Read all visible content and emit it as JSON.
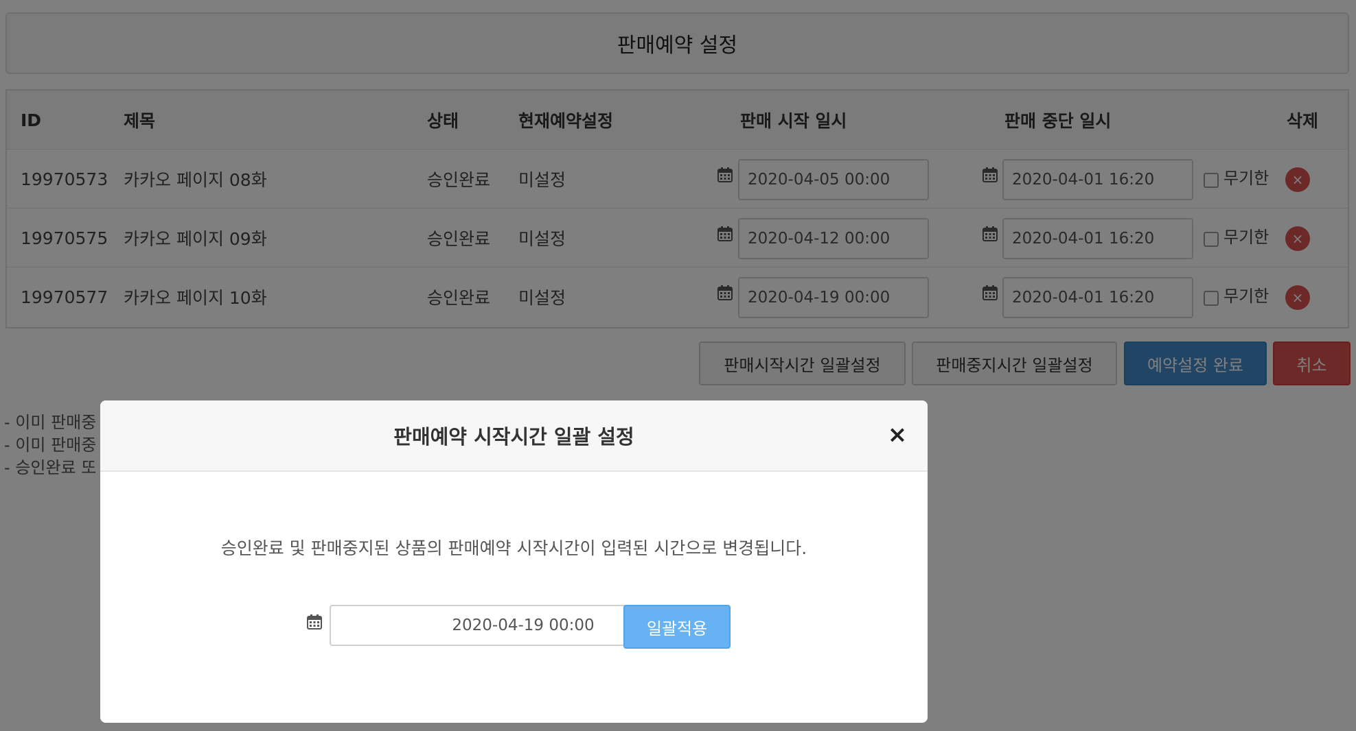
{
  "page": {
    "title": "판매예약 설정"
  },
  "table": {
    "headers": {
      "id": "ID",
      "title": "제목",
      "status": "상태",
      "current": "현재예약설정",
      "start": "판매 시작 일시",
      "stop": "판매 중단 일시",
      "delete": "삭제"
    },
    "rows": [
      {
        "id": "19970573",
        "title": "카카오 페이지 08화",
        "status": "승인완료",
        "current": "미설정",
        "start": "2020-04-05 00:00",
        "stop": "2020-04-01 16:20",
        "unlimited_label": "무기한",
        "unlimited_checked": false
      },
      {
        "id": "19970575",
        "title": "카카오 페이지 09화",
        "status": "승인완료",
        "current": "미설정",
        "start": "2020-04-12 00:00",
        "stop": "2020-04-01 16:20",
        "unlimited_label": "무기한",
        "unlimited_checked": false
      },
      {
        "id": "19970577",
        "title": "카카오 페이지 10화",
        "status": "승인완료",
        "current": "미설정",
        "start": "2020-04-19 00:00",
        "stop": "2020-04-01 16:20",
        "unlimited_label": "무기한",
        "unlimited_checked": false
      }
    ],
    "delete_glyph": "×"
  },
  "actions": {
    "bulk_start_label": "판매시작시간 일괄설정",
    "bulk_stop_label": "판매중지시간 일괄설정",
    "complete_label": "예약설정 완료",
    "cancel_label": "취소"
  },
  "notes": [
    "- 이미 판매중",
    "- 이미 판매중",
    "- 승인완료 또"
  ],
  "modal": {
    "title": "판매예약 시작시간 일괄 설정",
    "close_glyph": "×",
    "description": "승인완료 및 판매중지된 상품의 판매예약 시작시간이 입력된 시간으로 변경됩니다.",
    "date_value": "2020-04-19 00:00",
    "apply_label": "일괄적용"
  },
  "colors": {
    "primary": "#428bca",
    "danger": "#d9534f",
    "apply": "#67b2f2",
    "overlay": "rgba(0,0,0,0.5)"
  },
  "icons": {
    "calendar": "calendar-icon",
    "close": "close-icon",
    "delete": "delete-icon"
  }
}
